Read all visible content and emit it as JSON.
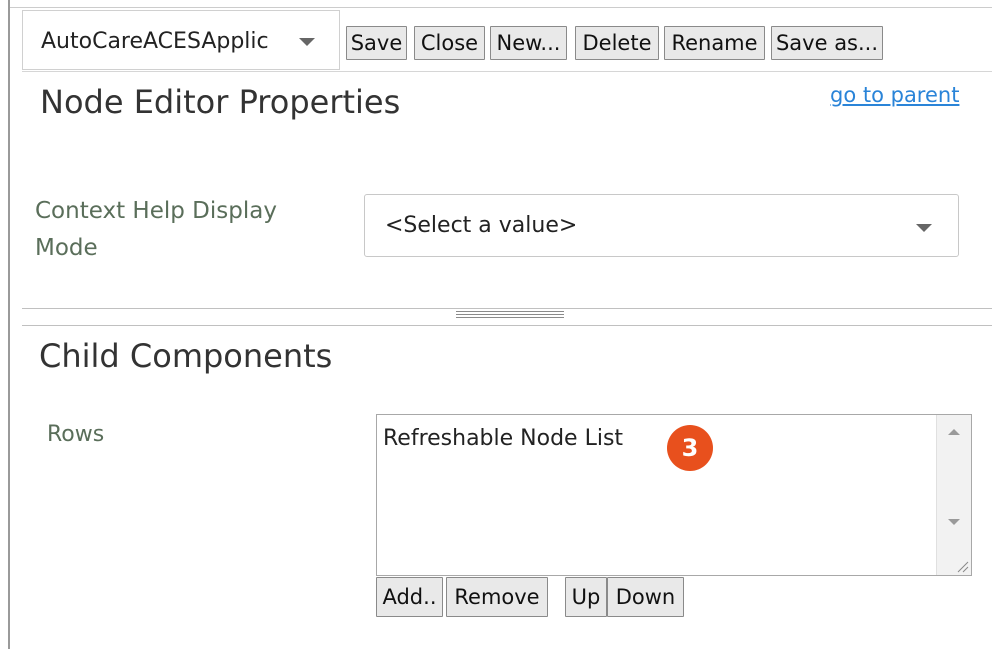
{
  "toolbar": {
    "document_select": "AutoCareACESApplic",
    "save_label": "Save",
    "close_label": "Close",
    "new_label": "New...",
    "delete_label": "Delete",
    "rename_label": "Rename",
    "save_as_label": "Save as..."
  },
  "properties": {
    "title": "Node Editor Properties",
    "go_to_parent_label": "go to parent",
    "context_help_label": "Context Help Display Mode",
    "context_help_value": "<Select a value>"
  },
  "child_components": {
    "title": "Child Components",
    "rows_label": "Rows",
    "rows_items": [
      "Refreshable Node List"
    ],
    "badge_number": "3",
    "buttons": {
      "add_label": "Add..",
      "remove_label": "Remove",
      "up_label": "Up",
      "down_label": "Down"
    }
  },
  "colors": {
    "link": "#2a84d8",
    "badge": "#e8501d",
    "label_text": "#5a6e5a"
  }
}
